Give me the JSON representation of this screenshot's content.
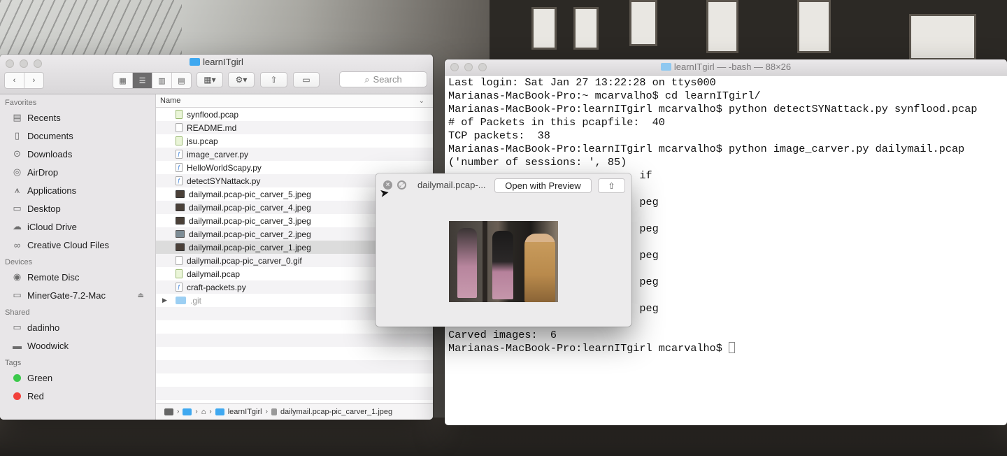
{
  "finder": {
    "title": "learnITgirl",
    "search_placeholder": "Search",
    "sidebar": {
      "favorites_label": "Favorites",
      "favorites": [
        {
          "label": "Recents",
          "icon": "recents-icon"
        },
        {
          "label": "Documents",
          "icon": "documents-icon"
        },
        {
          "label": "Downloads",
          "icon": "downloads-icon"
        },
        {
          "label": "AirDrop",
          "icon": "airdrop-icon"
        },
        {
          "label": "Applications",
          "icon": "applications-icon"
        },
        {
          "label": "Desktop",
          "icon": "desktop-icon"
        },
        {
          "label": "iCloud Drive",
          "icon": "cloud-icon"
        },
        {
          "label": "Creative Cloud Files",
          "icon": "creative-cloud-icon"
        }
      ],
      "devices_label": "Devices",
      "devices": [
        {
          "label": "Remote Disc",
          "icon": "disc-icon"
        },
        {
          "label": "MinerGate-7.2-Mac",
          "icon": "drive-icon"
        }
      ],
      "shared_label": "Shared",
      "shared": [
        {
          "label": "dadinho",
          "icon": "computer-icon"
        },
        {
          "label": "Woodwick",
          "icon": "server-icon"
        }
      ],
      "tags_label": "Tags",
      "tags": [
        {
          "label": "Green",
          "color": "#3bc94b"
        },
        {
          "label": "Red",
          "color": "#f2413b"
        }
      ]
    },
    "column_header": "Name",
    "files": [
      {
        "name": "synflood.pcap",
        "kind": "pcap"
      },
      {
        "name": "README.md",
        "kind": "doc"
      },
      {
        "name": "jsu.pcap",
        "kind": "pcap"
      },
      {
        "name": "image_carver.py",
        "kind": "py"
      },
      {
        "name": "HelloWorldScapy.py",
        "kind": "py"
      },
      {
        "name": "detectSYNattack.py",
        "kind": "py"
      },
      {
        "name": "dailymail.pcap-pic_carver_5.jpeg",
        "kind": "img"
      },
      {
        "name": "dailymail.pcap-pic_carver_4.jpeg",
        "kind": "img"
      },
      {
        "name": "dailymail.pcap-pic_carver_3.jpeg",
        "kind": "img"
      },
      {
        "name": "dailymail.pcap-pic_carver_2.jpeg",
        "kind": "img2"
      },
      {
        "name": "dailymail.pcap-pic_carver_1.jpeg",
        "kind": "img",
        "selected": true
      },
      {
        "name": "dailymail.pcap-pic_carver_0.gif",
        "kind": "doc"
      },
      {
        "name": "dailymail.pcap",
        "kind": "pcap"
      },
      {
        "name": "craft-packets.py",
        "kind": "py"
      },
      {
        "name": ".git",
        "kind": "folder"
      }
    ],
    "path": {
      "folder": "learnITgirl",
      "file": "dailymail.pcap-pic_carver_1.jpeg"
    }
  },
  "terminal": {
    "title": "learnITgirl — -bash — 88×26",
    "lines": [
      "Last login: Sat Jan 27 13:22:28 on ttys000",
      "Marianas-MacBook-Pro:~ mcarvalho$ cd learnITgirl/",
      "Marianas-MacBook-Pro:learnITgirl mcarvalho$ python detectSYNattack.py synflood.pcap",
      "# of Packets in this pcapfile:  40",
      "TCP packets:  38",
      "Marianas-MacBook-Pro:learnITgirl mcarvalho$ python image_carver.py dailymail.pcap",
      "('number of sessions: ', 85)",
      "                              if",
      "",
      "                              peg",
      "",
      "                              peg",
      "",
      "                              peg",
      "",
      "                              peg",
      "",
      "                              peg",
      "",
      "Carved images:  6",
      "Marianas-MacBook-Pro:learnITgirl mcarvalho$ "
    ]
  },
  "quicklook": {
    "title": "dailymail.pcap-...",
    "open_button": "Open with Preview"
  },
  "colors": {
    "selection_row": "#dcdcdc",
    "folder_blue": "#3fa8f0"
  }
}
